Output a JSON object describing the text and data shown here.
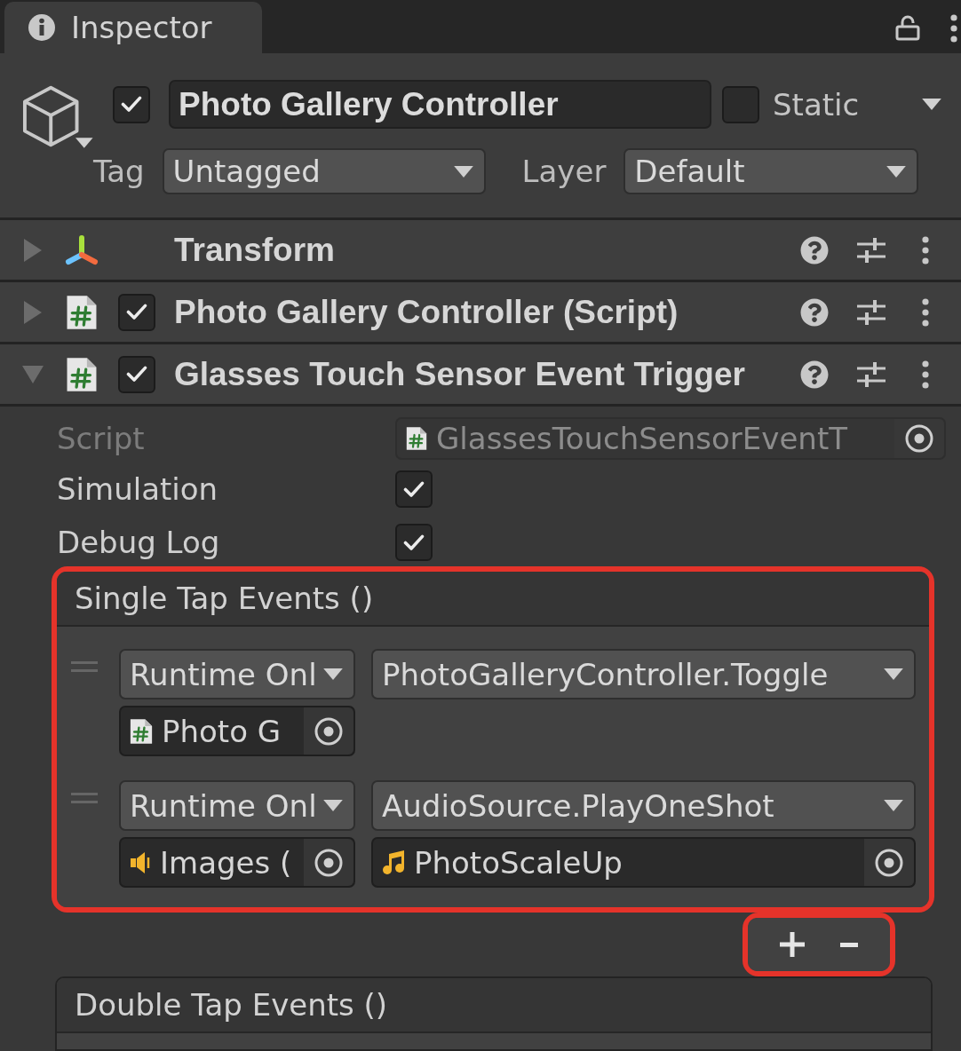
{
  "tab": {
    "title": "Inspector",
    "selected": true
  },
  "object": {
    "active": true,
    "name": "Photo Gallery Controller",
    "static": false,
    "static_label": "Static",
    "tag_label": "Tag",
    "tag": "Untagged",
    "layer_label": "Layer",
    "layer": "Default"
  },
  "components": [
    {
      "kind": "transform",
      "title": "Transform",
      "expanded": false
    },
    {
      "kind": "script",
      "title": "Photo Gallery Controller (Script)",
      "enabled": true,
      "expanded": false
    },
    {
      "kind": "script",
      "title": "Glasses Touch Sensor Event Trigger",
      "enabled": true,
      "expanded": true,
      "fields": [
        {
          "kind": "object",
          "label": "Script",
          "disabled": true,
          "value": "GlassesTouchSensorEventT"
        },
        {
          "kind": "toggle",
          "label": "Simulation",
          "checked": true
        },
        {
          "kind": "toggle",
          "label": "Debug Log",
          "checked": true
        }
      ],
      "event_lists": [
        {
          "title": "Single Tap Events ()",
          "highlighted": true,
          "entries": [
            {
              "call_state": "Runtime Onl",
              "function": "PhotoGalleryController.Toggle",
              "target": {
                "kind": "script",
                "name": "Photo G"
              }
            },
            {
              "call_state": "Runtime Onl",
              "function": "AudioSource.PlayOneShot",
              "target": {
                "kind": "audio_source",
                "name": "Images ("
              },
              "argument": {
                "kind": "audio_clip",
                "name": "PhotoScaleUp"
              }
            }
          ],
          "footer": {
            "highlighted": true
          }
        },
        {
          "title": "Double Tap Events ()",
          "highlighted": false
        }
      ]
    }
  ]
}
